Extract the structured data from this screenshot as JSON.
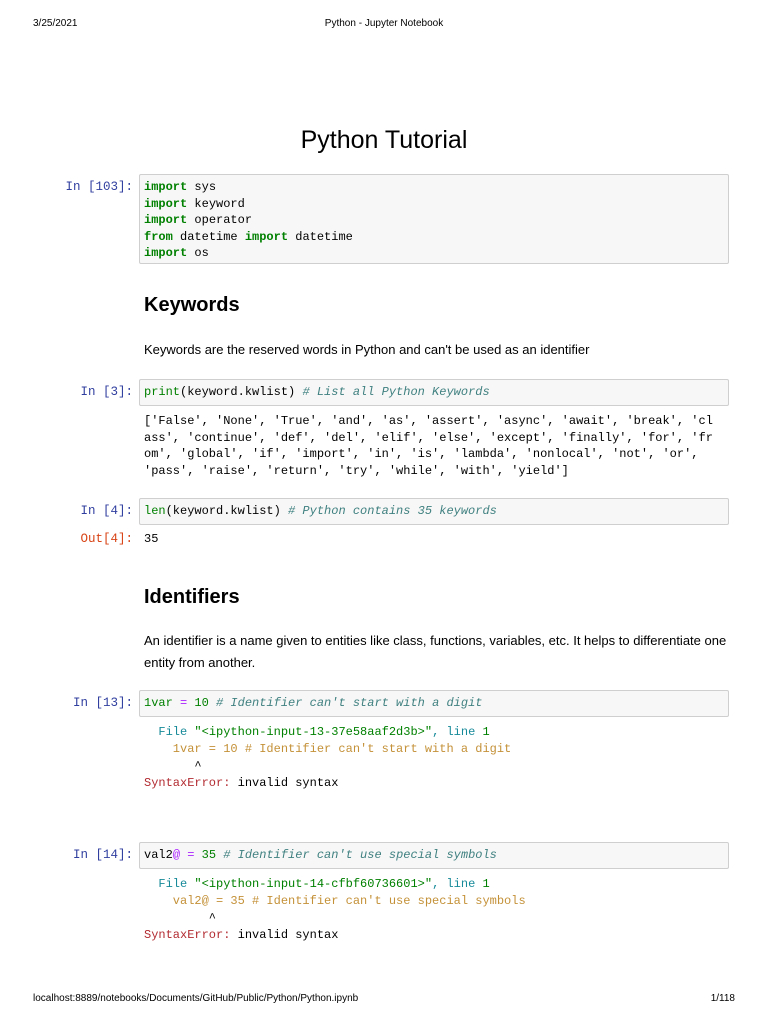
{
  "header": {
    "date": "3/25/2021",
    "title": "Python - Jupyter Notebook"
  },
  "footer": {
    "url": "localhost:8889/notebooks/Documents/GitHub/Public/Python/Python.ipynb",
    "page": "1/118"
  },
  "title": "Python Tutorial",
  "cells": [
    {
      "prompt": "In [103]:",
      "lines": [
        [
          [
            "import",
            "kw"
          ],
          [
            " sys",
            ""
          ]
        ],
        [
          [
            "import",
            "kw"
          ],
          [
            " keyword",
            ""
          ]
        ],
        [
          [
            "import",
            "kw"
          ],
          [
            " operator",
            ""
          ]
        ],
        [
          [
            "from",
            "kw"
          ],
          [
            " datetime ",
            ""
          ],
          [
            "import",
            "kw"
          ],
          [
            " datetime",
            ""
          ]
        ],
        [
          [
            "import",
            "kw"
          ],
          [
            " os",
            ""
          ]
        ]
      ]
    },
    {
      "prompt": "In [3]:",
      "lines": [
        [
          [
            "print",
            "fn"
          ],
          [
            "(keyword.kwlist) ",
            ""
          ],
          [
            "# List all Python Keywords",
            "cm"
          ]
        ]
      ],
      "output": [
        "['False', 'None', 'True', 'and', 'as', 'assert', 'async', 'await', 'break', 'cl",
        "ass', 'continue', 'def', 'del', 'elif', 'else', 'except', 'finally', 'for', 'fr",
        "om', 'global', 'if', 'import', 'in', 'is', 'lambda', 'nonlocal', 'not', 'or',",
        "'pass', 'raise', 'return', 'try', 'while', 'with', 'yield']"
      ]
    },
    {
      "prompt": "In [4]:",
      "lines": [
        [
          [
            "len",
            "fn"
          ],
          [
            "(keyword.kwlist) ",
            ""
          ],
          [
            "# Python contains 35 keywords",
            "cm"
          ]
        ]
      ],
      "out_prompt": "Out[4]:",
      "output": [
        "35"
      ]
    },
    {
      "prompt": "In [13]:",
      "lines": [
        [
          [
            "1var",
            "num"
          ],
          [
            " ",
            ""
          ],
          [
            "=",
            "op"
          ],
          [
            " ",
            ""
          ],
          [
            "10",
            "num"
          ],
          [
            " ",
            ""
          ],
          [
            "# Identifier can't start with a digit",
            "cm"
          ]
        ]
      ],
      "traceback": [
        [
          [
            "  File ",
            "cy"
          ],
          [
            "\"<ipython-input-13-37e58aaf2d3b>\"",
            "line"
          ],
          [
            ", line ",
            "cy"
          ],
          [
            "1",
            "line"
          ]
        ],
        [
          [
            "    1var = 10 # Identifier can't start with a digit",
            "tb"
          ]
        ],
        [
          [
            "       ^",
            ""
          ]
        ],
        [
          [
            "SyntaxError:",
            "err"
          ],
          [
            " invalid syntax",
            ""
          ]
        ]
      ]
    },
    {
      "prompt": "In [14]:",
      "lines": [
        [
          [
            "val2",
            ""
          ],
          [
            "@",
            "at"
          ],
          [
            " ",
            ""
          ],
          [
            "=",
            "op"
          ],
          [
            " ",
            ""
          ],
          [
            "35",
            "num"
          ],
          [
            " ",
            ""
          ],
          [
            "# Identifier can't use special symbols",
            "cm"
          ]
        ]
      ],
      "traceback": [
        [
          [
            "  File ",
            "cy"
          ],
          [
            "\"<ipython-input-14-cfbf60736601>\"",
            "line"
          ],
          [
            ", line ",
            "cy"
          ],
          [
            "1",
            "line"
          ]
        ],
        [
          [
            "    val2@ = 35 # Identifier can't use special symbols",
            "tb"
          ]
        ],
        [
          [
            "         ^",
            ""
          ]
        ],
        [
          [
            "SyntaxError:",
            "err"
          ],
          [
            " invalid syntax",
            ""
          ]
        ]
      ]
    }
  ],
  "sections": {
    "keywords": {
      "heading": "Keywords",
      "text": "Keywords are the reserved words in Python and can't be used as an identifier"
    },
    "identifiers": {
      "heading": "Identifiers",
      "text": "An identifier is a name given to entities like class, functions, variables, etc. It helps to differentiate one entity from another."
    }
  }
}
